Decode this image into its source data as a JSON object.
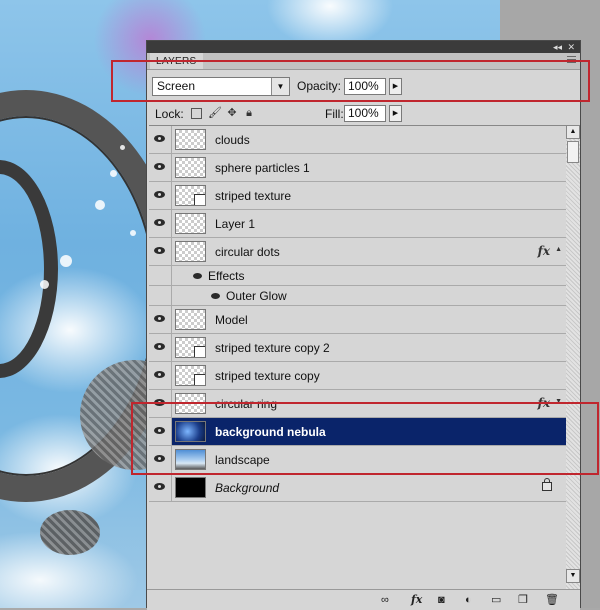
{
  "panel": {
    "tab": "LAYERS",
    "blend_mode": "Screen",
    "opacity_label": "Opacity:",
    "opacity_value": "100%",
    "lock_label": "Lock:",
    "fill_label": "Fill:",
    "fill_value": "100%"
  },
  "layers": [
    {
      "name": "clouds",
      "thumb": "transparent"
    },
    {
      "name": "sphere particles 1",
      "thumb": "transparent"
    },
    {
      "name": "striped texture",
      "thumb": "smart-object"
    },
    {
      "name": "Layer 1",
      "thumb": "transparent"
    },
    {
      "name": "circular dots",
      "thumb": "transparent",
      "fx": "fx"
    },
    {
      "name": "Effects"
    },
    {
      "name": "Outer Glow"
    },
    {
      "name": "Model",
      "thumb": "transparent"
    },
    {
      "name": "striped texture copy 2",
      "thumb": "smart-object"
    },
    {
      "name": "striped texture copy",
      "thumb": "smart-object"
    },
    {
      "name": "circular ring",
      "thumb": "transparent",
      "fx": "fx"
    },
    {
      "name": "background nebula",
      "thumb": "nebula",
      "selected": true
    },
    {
      "name": "landscape",
      "thumb": "landscape"
    },
    {
      "name": "Background",
      "thumb": "black",
      "locked": true
    }
  ],
  "icons": {
    "bottom": [
      "link-icon",
      "fx-icon",
      "mask-icon",
      "adjustment-icon",
      "folder-icon",
      "new-layer-icon",
      "trash-icon"
    ]
  },
  "highlight_color": "#c0262e",
  "selected_color": "#0a246a"
}
